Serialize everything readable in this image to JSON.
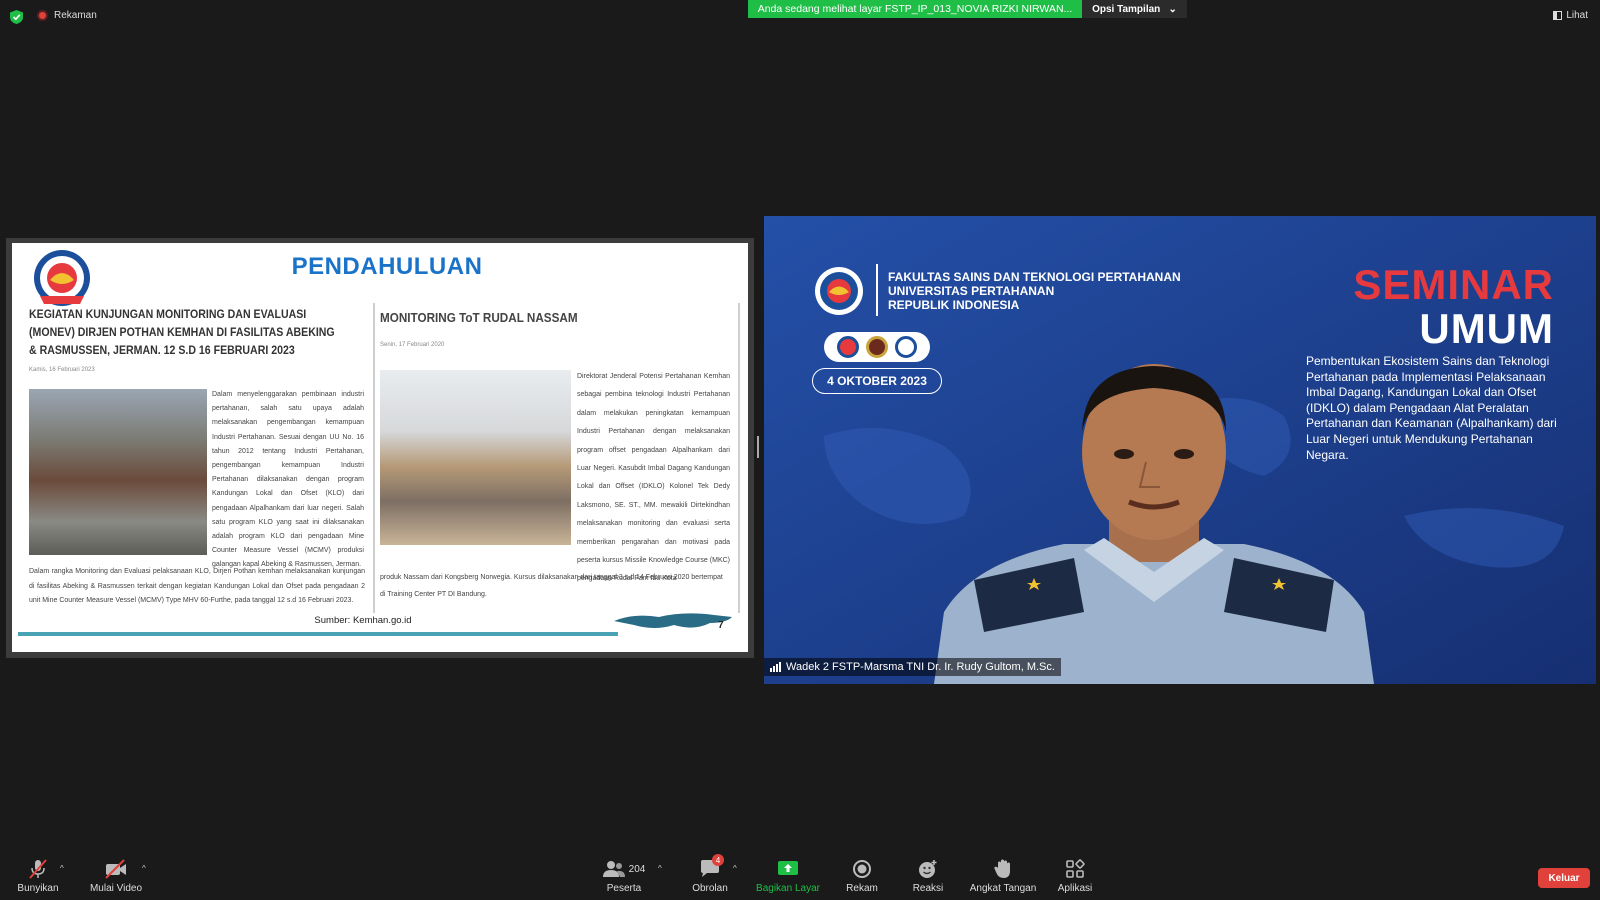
{
  "topbar": {
    "recording_label": "Rekaman",
    "share_banner": "Anda sedang melihat layar FSTP_IP_013_NOVIA RIZKI NIRWAN...",
    "view_options": "Opsi Tampilan",
    "view_label": "Lihat"
  },
  "slide": {
    "title": "PENDAHULUAN",
    "article1": {
      "title": "KEGIATAN KUNJUNGAN MONITORING DAN EVALUASI (MONEV) DIRJEN POTHAN KEMHAN DI FASILITAS ABEKING & RASMUSSEN, JERMAN. 12 S.D 16 FEBRUARI 2023",
      "date": "Kamis, 16 Februari 2023",
      "side_text": "Dalam menyelenggarakan pembinaan industri pertahanan, salah satu upaya adalah melaksanakan pengembangan kemampuan Industri Pertahanan. Sesuai dengan UU No. 16 tahun 2012 tentang Industri Pertahanan, pengembangan kemampuan Industri Pertahanan dilaksanakan dengan program Kandungan Lokal dan Ofset (KLO) dari pengadaan Alpalhankam dari luar negeri. Salah satu program KLO yang saat ini dilaksanakan adalah program KLO dari pengadaan Mine Counter Measure Vessel (MCMV) produksi galangan kapal Abeking & Rasmussen, Jerman.",
      "bottom_text": "Dalam rangka Monitoring dan Evaluasi pelaksanaan KLO, Dirjen Pothan kemhan melaksanakan kunjungan di fasilitas Abeking & Rasmussen terkait dengan kegiatan Kandungan Lokal dan Ofset pada pengadaan 2 unit Mine Counter Measure Vessel (MCMV) Type MHV 60-Furthe, pada tanggal 12 s.d 16 Februari 2023."
    },
    "article2": {
      "title": "MONITORING ToT RUDAL NASSAM",
      "date": "Senin, 17 Februari 2020",
      "side_text": "Direktorat Jenderal Potensi Pertahanan Kemhan sebagai pembina teknologi Industri Pertahanan dalam melakukan peningkatan kemampuan Industri Pertahanan dengan melaksanakan program offset pengadaan Alpalhankam dari Luar Negeri. Kasubdit Imbal Dagang Kandungan Lokal dan Offset (IDKLO) Kolonel Tek Dedy Laksmono, SE. ST., MM. mewakili Dirtekindhan melaksanakan monitoring dan evaluasi serta memberikan pengarahan dan motivasi pada peserta kursus Missile Knowledge Course (MKC) pengadaan Rudal Pam Ibu Kota",
      "bottom_text": "produk Nassam dari Kongsberg Norwegia. Kursus dilaksanakan dari tanggal 3 s.d 14 Februari 2020 bertempat di Training Center PT DI Bandung."
    },
    "source": "Sumber: Kemhan.go.id",
    "page_number": "7"
  },
  "video": {
    "institution_lines": [
      "FAKULTAS SAINS DAN TEKNOLOGI PERTAHANAN",
      "UNIVERSITAS PERTAHANAN",
      "REPUBLIK INDONESIA"
    ],
    "event_date": "4 OKTOBER 2023",
    "seminar_word1": "SEMINAR",
    "seminar_word2": "UMUM",
    "description": "Pembentukan Ekosistem Sains dan Teknologi Pertahanan pada Implementasi Pelaksanaan Imbal Dagang, Kandungan Lokal dan Ofset (IDKLO) dalam Pengadaan Alat Peralatan Pertahanan dan Keamanan (Alpalhankam) dari Luar Negeri untuk Mendukung Pertahanan Negara.",
    "participant_name": "Wadek 2 FSTP-Marsma TNI Dr. Ir. Rudy Gultom, M.Sc."
  },
  "toolbar": {
    "unmute": "Bunyikan",
    "start_video": "Mulai Video",
    "participants": "Peserta",
    "participants_count": "204",
    "chat": "Obrolan",
    "chat_badge": "4",
    "share_screen": "Bagikan Layar",
    "record": "Rekam",
    "reactions": "Reaksi",
    "raise_hand": "Angkat Tangan",
    "apps": "Aplikasi",
    "leave": "Keluar"
  },
  "colors": {
    "background": "#1a1a1a",
    "share_green": "#1fbf47",
    "leave_red": "#e0413a",
    "slide_title_blue": "#1b73c9",
    "video_blue": "#1f3f8f",
    "seminar_red": "#e73a3f"
  }
}
